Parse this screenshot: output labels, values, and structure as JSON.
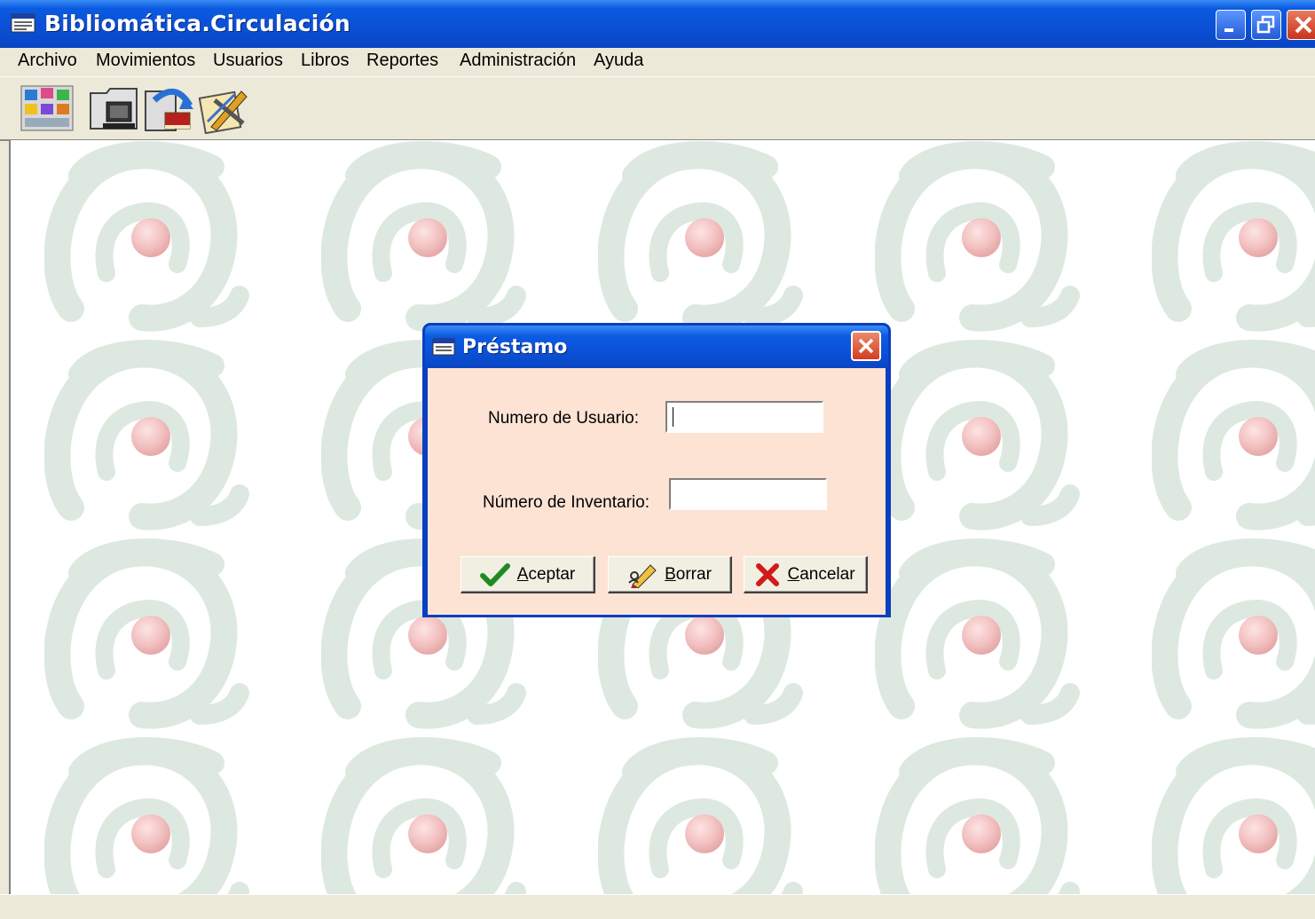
{
  "window": {
    "title": "Bibliomática.Circulación"
  },
  "menu": [
    "Archivo",
    "Movimientos",
    "Usuarios",
    "Libros",
    "Reportes",
    "Administración",
    "Ayuda"
  ],
  "toolbar": {
    "icons": [
      "modules-icon",
      "computer-folder-icon",
      "book-return-icon",
      "edit-tools-icon"
    ]
  },
  "dialog": {
    "title": "Préstamo",
    "user_label": "Numero de Usuario:",
    "user_value": "",
    "inventory_label": "Número de Inventario:",
    "inventory_value": "",
    "accept": {
      "accel": "A",
      "rest": "ceptar"
    },
    "clear": {
      "accel": "B",
      "rest": "orrar"
    },
    "cancel": {
      "accel": "C",
      "rest": "ancelar"
    }
  },
  "colors": {
    "titlebar": "#0b4fd4",
    "dialog_body": "#fde3d4",
    "pattern_green": "#dde9e0",
    "pattern_red": "#f3c2c2"
  }
}
